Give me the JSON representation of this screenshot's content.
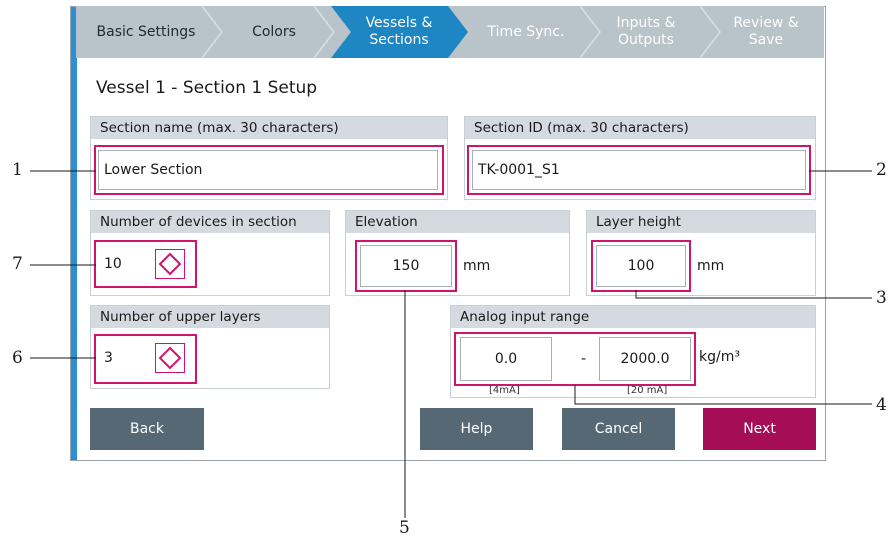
{
  "steps": [
    {
      "label_line1": "Basic Settings",
      "label_line2": "",
      "state": "done"
    },
    {
      "label_line1": "Colors",
      "label_line2": "",
      "state": "done"
    },
    {
      "label_line1": "Vessels &",
      "label_line2": "Sections",
      "state": "active"
    },
    {
      "label_line1": "Time Sync.",
      "label_line2": "",
      "state": "future"
    },
    {
      "label_line1": "Inputs &",
      "label_line2": "Outputs",
      "state": "future"
    },
    {
      "label_line1": "Review &",
      "label_line2": "Save",
      "state": "future"
    }
  ],
  "page_title": "Vessel 1 - Section 1 Setup",
  "section_name": {
    "label": "Section name (max. 30 characters)",
    "value": "Lower Section"
  },
  "section_id": {
    "label": "Section ID (max. 30 characters)",
    "value": "TK-0001_S1"
  },
  "devices": {
    "label": "Number of devices in section",
    "value": "10"
  },
  "elevation": {
    "label": "Elevation",
    "value": "150",
    "unit": "mm"
  },
  "layer_height": {
    "label": "Layer height",
    "value": "100",
    "unit": "mm"
  },
  "upper_layers": {
    "label": "Number of upper layers",
    "value": "3"
  },
  "analog": {
    "label": "Analog input range",
    "min": "0.0",
    "separator": "-",
    "max": "2000.0",
    "unit": "kg/m³",
    "min_caption": "[4mA]",
    "max_caption": "[20 mA]"
  },
  "buttons": {
    "back": "Back",
    "help": "Help",
    "cancel": "Cancel",
    "next": "Next"
  },
  "callouts": {
    "c1": "1",
    "c2": "2",
    "c3": "3",
    "c4": "4",
    "c5": "5",
    "c6": "6",
    "c7": "7"
  },
  "colors": {
    "accent": "#2d8ed1",
    "highlight": "#d1146b",
    "primary_button": "#a50d56",
    "button": "#556873",
    "step_bar": "#b9c3ca"
  }
}
